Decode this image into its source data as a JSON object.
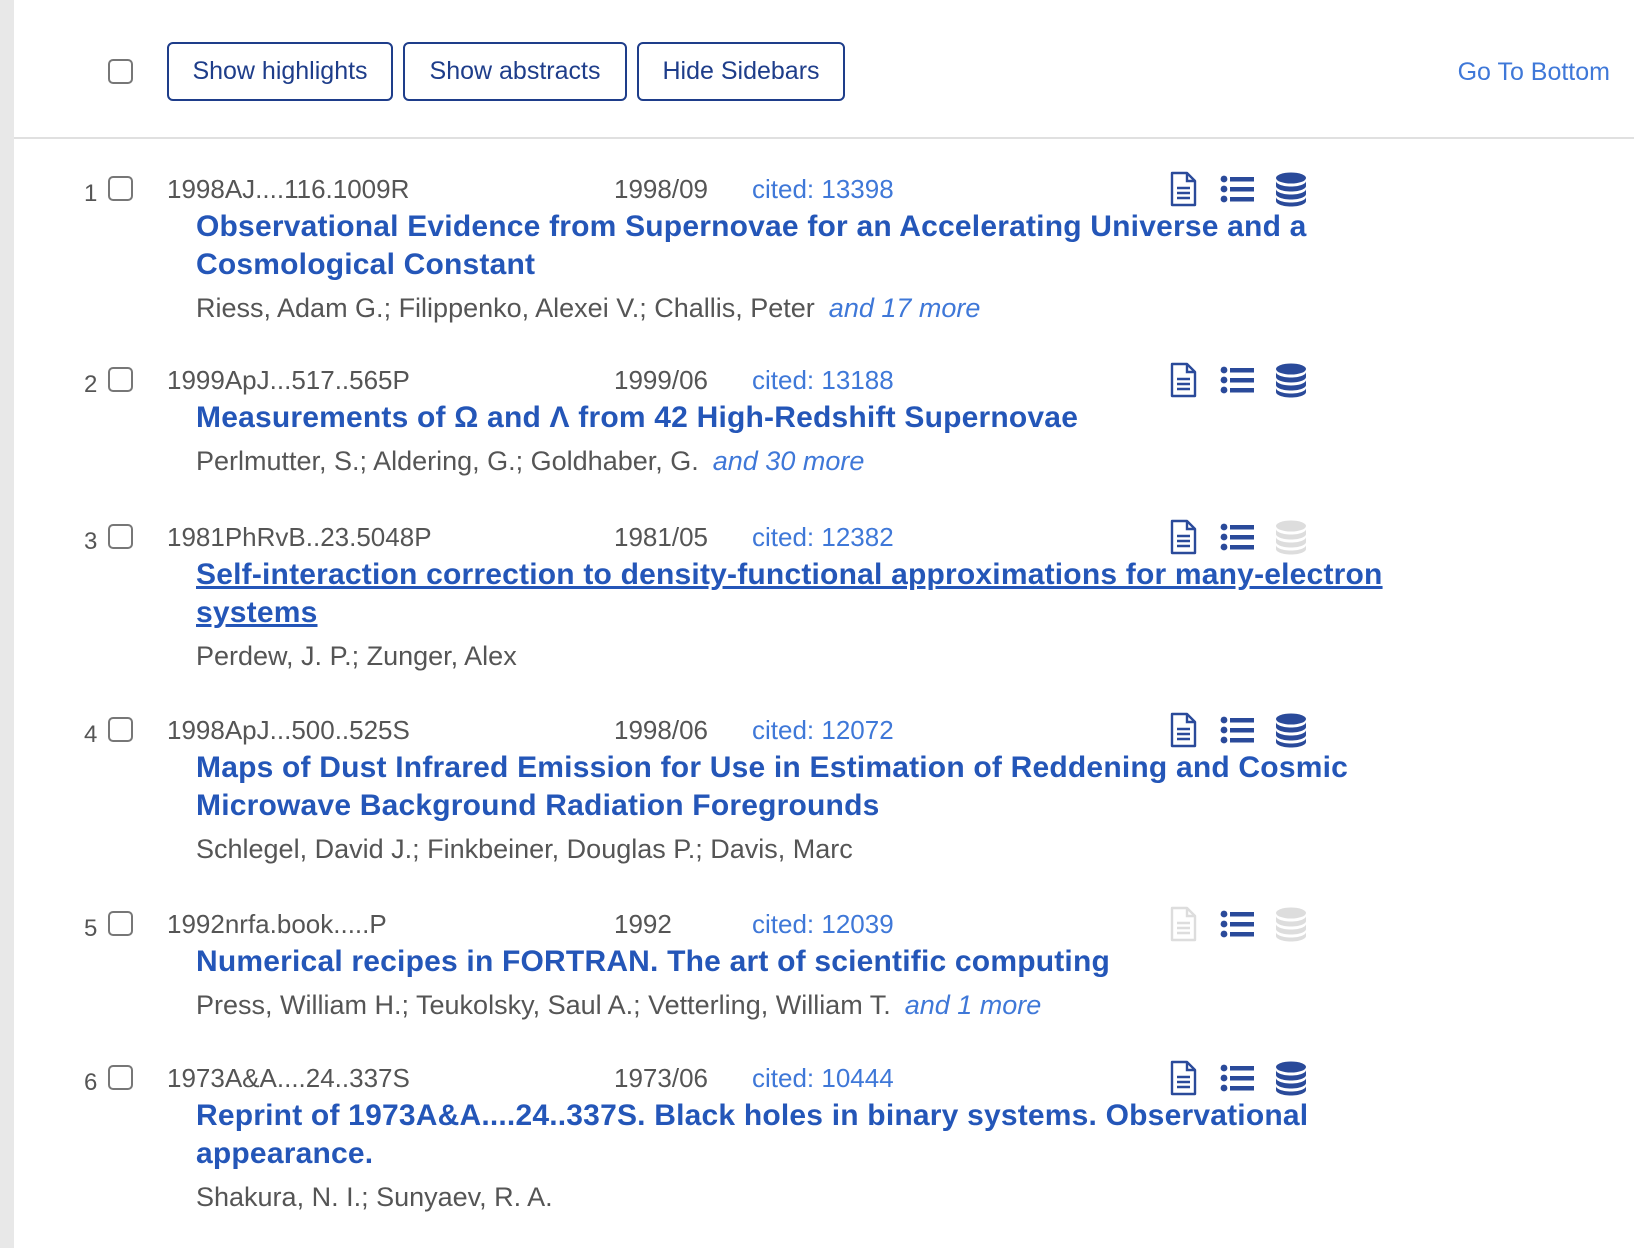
{
  "toolbar": {
    "show_highlights": "Show highlights",
    "show_abstracts": "Show abstracts",
    "hide_sidebars": "Hide Sidebars",
    "go_to_bottom": "Go To Bottom"
  },
  "colors": {
    "title": "#2456b8",
    "link": "#3f78d8",
    "icon_active": "#2a4a9a",
    "icon_disabled": "#dddddd",
    "button_border": "#1e3d8a"
  },
  "results": [
    {
      "num": "1",
      "bibcode": "1998AJ....116.1009R",
      "date": "1998/09",
      "cited": "cited: 13398",
      "title": "Observational Evidence from Supernovae for an Accelerating Universe and a Cosmological Constant",
      "authors": "Riess, Adam G.;  Filippenko, Alexei V.;  Challis, Peter",
      "more": "and 17 more",
      "icons": {
        "full-text-icon": true,
        "references-list-icon": true,
        "data-icon": true
      }
    },
    {
      "num": "2",
      "bibcode": "1999ApJ...517..565P",
      "date": "1999/06",
      "cited": "cited: 13188",
      "title": "Measurements of Ω and Λ from 42 High-Redshift Supernovae",
      "authors": "Perlmutter, S.;  Aldering, G.;  Goldhaber, G.",
      "more": "and 30 more",
      "icons": {
        "full-text-icon": true,
        "references-list-icon": true,
        "data-icon": true
      }
    },
    {
      "num": "3",
      "bibcode": "1981PhRvB..23.5048P",
      "date": "1981/05",
      "cited": "cited: 12382",
      "title": "Self-interaction correction to density-functional approximations for many-electron systems",
      "authors": "Perdew, J. P.;  Zunger, Alex",
      "more": "",
      "icons": {
        "full-text-icon": true,
        "references-list-icon": true,
        "data-icon": false
      }
    },
    {
      "num": "4",
      "bibcode": "1998ApJ...500..525S",
      "date": "1998/06",
      "cited": "cited: 12072",
      "title": "Maps of Dust Infrared Emission for Use in Estimation of Reddening and Cosmic Microwave Background Radiation Foregrounds",
      "authors": "Schlegel, David J.;  Finkbeiner, Douglas P.;  Davis, Marc",
      "more": "",
      "icons": {
        "full-text-icon": true,
        "references-list-icon": true,
        "data-icon": true
      }
    },
    {
      "num": "5",
      "bibcode": "1992nrfa.book.....P",
      "date": "1992",
      "cited": "cited: 12039",
      "title": "Numerical recipes in FORTRAN. The art of scientific computing",
      "authors": "Press, William H.;  Teukolsky, Saul A.;  Vetterling, William T.",
      "more": "and 1 more",
      "icons": {
        "full-text-icon": false,
        "references-list-icon": true,
        "data-icon": false
      }
    },
    {
      "num": "6",
      "bibcode": "1973A&A....24..337S",
      "date": "1973/06",
      "cited": "cited: 10444",
      "title": "Reprint of 1973A&A....24..337S. Black holes in binary systems. Observational appearance.",
      "authors": "Shakura, N. I.;  Sunyaev, R. A.",
      "more": "",
      "icons": {
        "full-text-icon": true,
        "references-list-icon": true,
        "data-icon": true
      }
    }
  ]
}
